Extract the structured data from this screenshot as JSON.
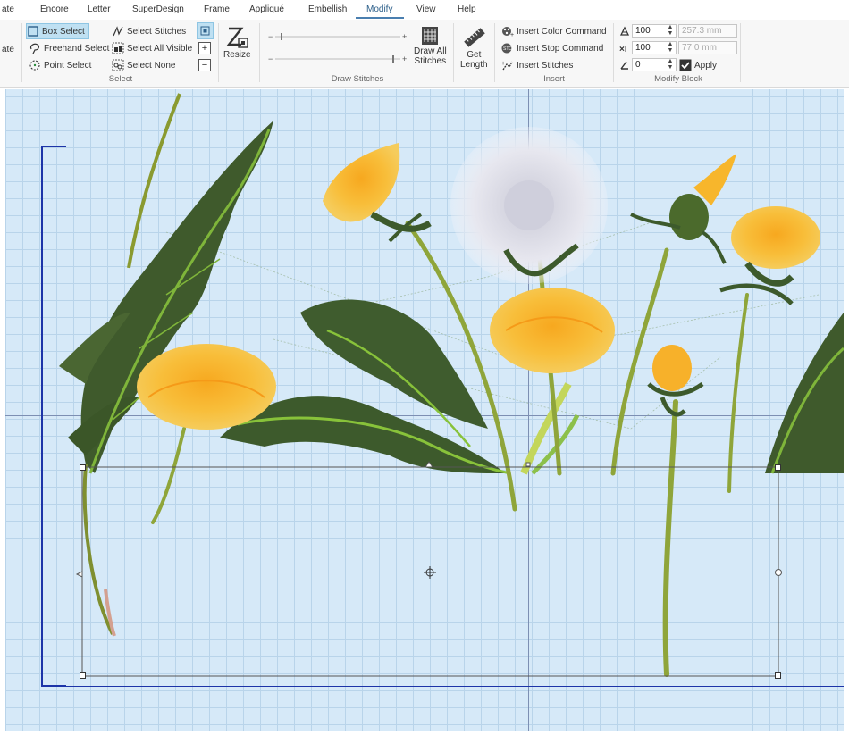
{
  "tabs": [
    {
      "label": "ate",
      "active": false
    },
    {
      "label": "Encore",
      "active": false
    },
    {
      "label": "Letter",
      "active": false
    },
    {
      "label": "SuperDesign",
      "active": false
    },
    {
      "label": "Frame",
      "active": false
    },
    {
      "label": "Appliqué",
      "active": false
    },
    {
      "label": "Embellish",
      "active": false
    },
    {
      "label": "Modify",
      "active": true
    },
    {
      "label": "View",
      "active": false
    },
    {
      "label": "Help",
      "active": false
    }
  ],
  "ribbon": {
    "left_cut": "ate",
    "select": {
      "box_select": "Box Select",
      "freehand_select": "Freehand Select",
      "point_select": "Point Select",
      "select_stitches": "Select Stitches",
      "select_all_visible": "Select All Visible",
      "select_none": "Select None",
      "group": "Select"
    },
    "resize": "Resize",
    "draw_stitches": {
      "draw_all_line1": "Draw All",
      "draw_all_line2": "Stitches",
      "group": "Draw Stitches"
    },
    "get_length_line1": "Get",
    "get_length_line2": "Length",
    "insert": {
      "insert_color_command": "Insert Color Command",
      "insert_stop_command": "Insert Stop Command",
      "insert_stitches": "Insert Stitches",
      "group": "Insert"
    },
    "modify_block": {
      "width_pct": "100",
      "width_mm": "257.3 mm",
      "height_pct": "100",
      "height_mm": "77.0 mm",
      "angle": "0",
      "apply": "Apply",
      "apply_checked": true,
      "group": "Modify Block"
    }
  },
  "colors": {
    "accent": "#4a7fb0",
    "canvas_bg": "#d6e9f8",
    "grid": "#b9d4ea",
    "hoop": "#1d34a8",
    "dandelion": "#f7b62c",
    "leaf": "#3f5a2c",
    "stem": "#8fa53a"
  },
  "icons": [
    "box-select-icon",
    "freehand-select-icon",
    "point-select-icon",
    "select-stitches-icon",
    "select-all-visible-icon",
    "select-none-icon",
    "resize-icon",
    "draw-all-stitches-icon",
    "get-length-icon",
    "insert-color-command-icon",
    "insert-stop-command-icon",
    "insert-stitches-icon",
    "width-icon",
    "height-icon",
    "angle-icon",
    "apply-checkbox-icon",
    "move-handle-icon"
  ]
}
